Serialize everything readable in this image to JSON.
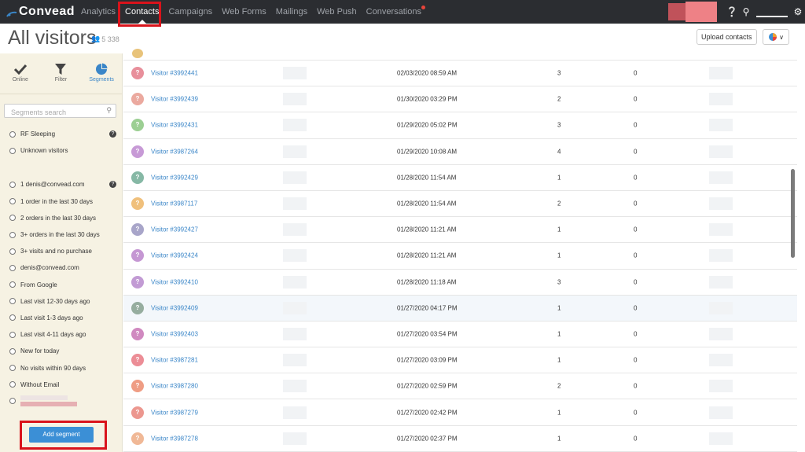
{
  "app": {
    "logo": "Convead"
  },
  "nav": [
    {
      "label": "Analytics"
    },
    {
      "label": "Contacts",
      "active": true
    },
    {
      "label": "Campaigns"
    },
    {
      "label": "Web Forms"
    },
    {
      "label": "Mailings"
    },
    {
      "label": "Web Push"
    },
    {
      "label": "Conversations",
      "notification": true
    }
  ],
  "header": {
    "title": "All visitors",
    "count": "5 338",
    "upload_label": "Upload contacts"
  },
  "sidebar": {
    "tabs": [
      {
        "label": "Online",
        "icon": "checkmark-icon"
      },
      {
        "label": "Filter",
        "icon": "filter-icon"
      },
      {
        "label": "Segments",
        "icon": "pie-chart-icon",
        "active": true
      }
    ],
    "search_placeholder": "Segments search",
    "segments_group1": [
      {
        "label": "RF Sleeping",
        "help": true
      },
      {
        "label": "Unknown visitors"
      }
    ],
    "segments_group2": [
      {
        "label": "1 denis@convead.com",
        "help": true
      },
      {
        "label": "1 order in the last 30 days"
      },
      {
        "label": "2 orders in the last 30 days"
      },
      {
        "label": "3+ orders in the last 30 days"
      },
      {
        "label": "3+ visits and no purchase"
      },
      {
        "label": "denis@convead.com"
      },
      {
        "label": "From Google"
      },
      {
        "label": "Last visit 12-30 days ago"
      },
      {
        "label": "Last visit 1-3 days ago"
      },
      {
        "label": "Last visit 4-11 days ago"
      },
      {
        "label": "New for today"
      },
      {
        "label": "No visits within 90 days"
      },
      {
        "label": "Without Email"
      }
    ],
    "add_segment_label": "Add segment"
  },
  "colors": {
    "accent": "#3a86c8",
    "nav_bg": "#2b2d31",
    "sidebar_bg": "#f6f2e3",
    "annotation_red": "#d9131b"
  },
  "rows": [
    {
      "name": "Visitor #3992441",
      "date": "02/03/2020 08:59 AM",
      "c1": "3",
      "c2": "0",
      "color": "#e88f9b"
    },
    {
      "name": "Visitor #3992439",
      "date": "01/30/2020 03:29 PM",
      "c1": "2",
      "c2": "0",
      "color": "#eba99f"
    },
    {
      "name": "Visitor #3992431",
      "date": "01/29/2020 05:02 PM",
      "c1": "3",
      "c2": "0",
      "color": "#9ccf93"
    },
    {
      "name": "Visitor #3987264",
      "date": "01/29/2020 10:08 AM",
      "c1": "4",
      "c2": "0",
      "color": "#c79ad6"
    },
    {
      "name": "Visitor #3992429",
      "date": "01/28/2020 11:54 AM",
      "c1": "1",
      "c2": "0",
      "color": "#86b8a5"
    },
    {
      "name": "Visitor #3987117",
      "date": "01/28/2020 11:54 AM",
      "c1": "2",
      "c2": "0",
      "color": "#f0c07c"
    },
    {
      "name": "Visitor #3992427",
      "date": "01/28/2020 11:21 AM",
      "c1": "1",
      "c2": "0",
      "color": "#a8a5c9"
    },
    {
      "name": "Visitor #3992424",
      "date": "01/28/2020 11:21 AM",
      "c1": "1",
      "c2": "0",
      "color": "#c597d3"
    },
    {
      "name": "Visitor #3992410",
      "date": "01/28/2020 11:18 AM",
      "c1": "3",
      "c2": "0",
      "color": "#c29bd4"
    },
    {
      "name": "Visitor #3992409",
      "date": "01/27/2020 04:17 PM",
      "c1": "1",
      "c2": "0",
      "color": "#96ad9f",
      "highlight": true
    },
    {
      "name": "Visitor #3992403",
      "date": "01/27/2020 03:54 PM",
      "c1": "1",
      "c2": "0",
      "color": "#d089c0"
    },
    {
      "name": "Visitor #3987281",
      "date": "01/27/2020 03:09 PM",
      "c1": "1",
      "c2": "0",
      "color": "#ec8d96"
    },
    {
      "name": "Visitor #3987280",
      "date": "01/27/2020 02:59 PM",
      "c1": "2",
      "c2": "0",
      "color": "#ef9d84"
    },
    {
      "name": "Visitor #3987279",
      "date": "01/27/2020 02:42 PM",
      "c1": "1",
      "c2": "0",
      "color": "#ec978f"
    },
    {
      "name": "Visitor #3987278",
      "date": "01/27/2020 02:37 PM",
      "c1": "1",
      "c2": "0",
      "color": "#f0b896"
    }
  ]
}
